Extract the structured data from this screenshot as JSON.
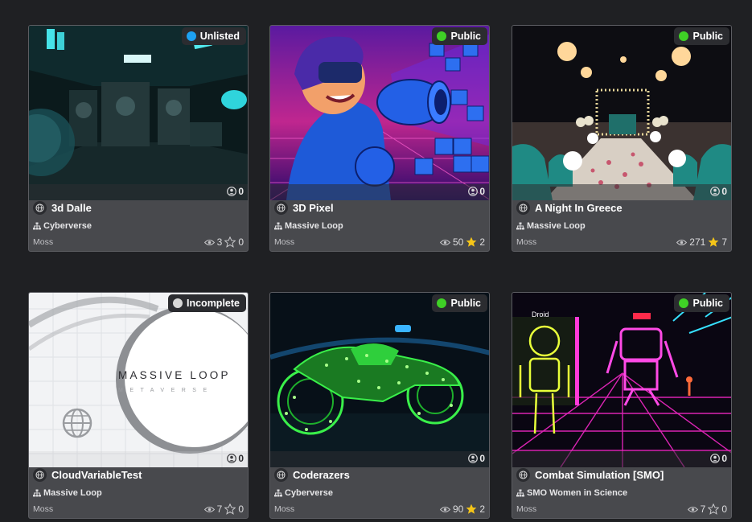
{
  "cards": [
    {
      "title": "3d Dalle",
      "status": "Unlisted",
      "status_color": "#1da1f2",
      "players": "0",
      "org": "Cyberverse",
      "author": "Moss",
      "views": "3",
      "favorites": "0",
      "starred": false
    },
    {
      "title": "3D Pixel",
      "status": "Public",
      "status_color": "#3fd126",
      "players": "0",
      "org": "Massive Loop",
      "author": "Moss",
      "views": "50",
      "favorites": "2",
      "starred": true
    },
    {
      "title": "A Night In Greece",
      "status": "Public",
      "status_color": "#3fd126",
      "players": "0",
      "org": "Massive Loop",
      "author": "Moss",
      "views": "271",
      "favorites": "7",
      "starred": true
    },
    {
      "title": "CloudVariableTest",
      "status": "Incomplete",
      "status_color": "#d8d8d8",
      "players": "0",
      "org": "Massive Loop",
      "author": "Moss",
      "views": "7",
      "favorites": "0",
      "starred": false,
      "thumb_text": "MASSIVE LOOP",
      "thumb_subtext": "METAVERSE"
    },
    {
      "title": "Coderazers",
      "status": "Public",
      "status_color": "#3fd126",
      "players": "0",
      "org": "Cyberverse",
      "author": "Moss",
      "views": "90",
      "favorites": "2",
      "starred": true
    },
    {
      "title": "Combat Simulation [SMO]",
      "status": "Public",
      "status_color": "#3fd126",
      "players": "0",
      "org": "SMO Women in Science",
      "author": "Moss",
      "views": "7",
      "favorites": "0",
      "starred": false,
      "thumb_text": "Droid"
    }
  ]
}
